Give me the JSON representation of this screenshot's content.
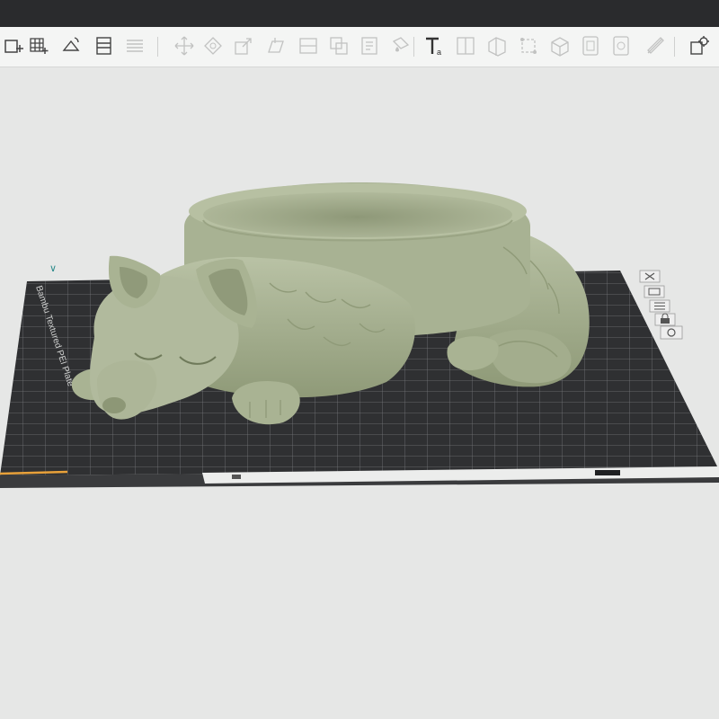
{
  "window": {
    "titlebar_color": "#2a2b2d"
  },
  "toolbar": {
    "background": "#f4f5f4",
    "tools": [
      {
        "id": "add-plate",
        "icon": "add-plate-icon",
        "enabled": true
      },
      {
        "id": "arrange",
        "icon": "grid-arrange-icon",
        "enabled": true
      },
      {
        "id": "auto-orient",
        "icon": "auto-orient-icon",
        "enabled": true
      },
      {
        "id": "plate-layout",
        "icon": "plate-layout-icon",
        "enabled": true
      },
      {
        "id": "layers",
        "icon": "layers-icon",
        "enabled": false
      },
      {
        "id": "move",
        "icon": "move-icon",
        "enabled": false
      },
      {
        "id": "rotate",
        "icon": "rotate-icon",
        "enabled": false
      },
      {
        "id": "scale",
        "icon": "scale-icon",
        "enabled": false
      },
      {
        "id": "lay-on-face",
        "icon": "lay-on-face-icon",
        "enabled": false
      },
      {
        "id": "cut",
        "icon": "cut-icon",
        "enabled": false
      },
      {
        "id": "boolean",
        "icon": "boolean-icon",
        "enabled": false
      },
      {
        "id": "support-paint",
        "icon": "support-paint-icon",
        "enabled": false
      },
      {
        "id": "color-paint",
        "icon": "color-paint-icon",
        "enabled": false
      },
      {
        "id": "text",
        "icon": "text-tool-icon",
        "enabled": true
      },
      {
        "id": "split-objects",
        "icon": "split-objects-icon",
        "enabled": false
      },
      {
        "id": "split-parts",
        "icon": "split-parts-icon",
        "enabled": false
      },
      {
        "id": "measure",
        "icon": "measure-icon",
        "enabled": false
      },
      {
        "id": "assembly",
        "icon": "assembly-icon",
        "enabled": false
      },
      {
        "id": "variable-layer",
        "icon": "variable-layer-icon",
        "enabled": false
      },
      {
        "id": "seam-paint",
        "icon": "seam-paint-icon",
        "enabled": false
      },
      {
        "id": "emboss",
        "icon": "emboss-icon",
        "enabled": false
      },
      {
        "id": "settings-panel",
        "icon": "settings-panel-icon",
        "enabled": true
      }
    ]
  },
  "viewport": {
    "background": "#e6e7e6",
    "plate": {
      "label": "Bambu Textured PEI Plate",
      "color": "#2f3032",
      "grid_color": "#7d7f82",
      "origin_marker_color": "#e8a13a"
    },
    "plate_side_tools": [
      {
        "id": "close-plate",
        "icon": "close-icon"
      },
      {
        "id": "plate-settings",
        "icon": "plate-settings-icon"
      },
      {
        "id": "arrange-plate",
        "icon": "arrange-icon"
      },
      {
        "id": "lock-plate",
        "icon": "lock-icon"
      },
      {
        "id": "orient-plate",
        "icon": "orient-icon"
      }
    ],
    "model": {
      "name": "sleeping fox bowl",
      "color": "#a8b293"
    }
  }
}
